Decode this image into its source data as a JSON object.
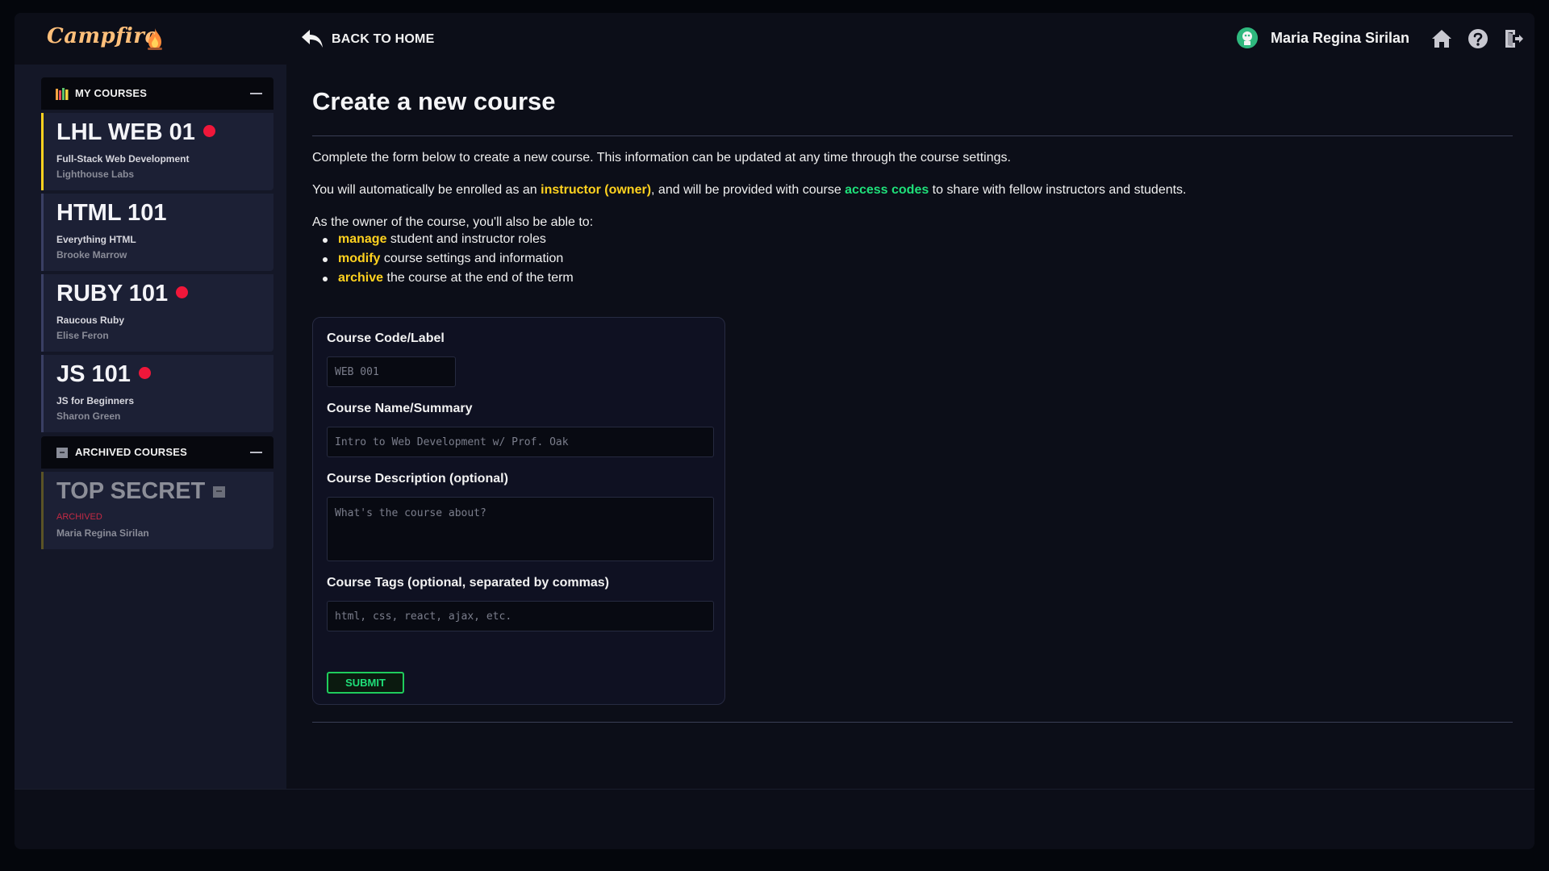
{
  "app": {
    "name": "Campfire"
  },
  "header": {
    "back_label": "BACK TO HOME",
    "user_name": "Maria Regina Sirilan"
  },
  "sidebar": {
    "my_courses": {
      "label": "MY COURSES",
      "items": [
        {
          "code": "LHL WEB 01",
          "name": "Full-Stack Web Development",
          "instructor": "Lighthouse Labs",
          "notification": true,
          "active": true
        },
        {
          "code": "HTML 101",
          "name": "Everything HTML",
          "instructor": "Brooke Marrow",
          "notification": false
        },
        {
          "code": "RUBY 101",
          "name": "Raucous Ruby",
          "instructor": "Elise Feron",
          "notification": true
        },
        {
          "code": "JS 101",
          "name": "JS for Beginners",
          "instructor": "Sharon Green",
          "notification": true
        }
      ]
    },
    "archived_courses": {
      "label": "ARCHIVED COURSES",
      "items": [
        {
          "code": "TOP SECRET",
          "status": "ARCHIVED",
          "instructor": "Maria Regina Sirilan"
        }
      ]
    }
  },
  "main": {
    "title": "Create a new course",
    "intro": "Complete the form below to create a new course. This information can be updated at any time through the course settings.",
    "enroll": {
      "pre": "You will automatically be enrolled as an ",
      "role": "instructor (owner)",
      "mid": ", and will be provided with course ",
      "codes": "access codes",
      "post": " to share with fellow instructors and students."
    },
    "owner_intro": "As the owner of the course, you'll also be able to:",
    "abilities": [
      {
        "verb": "manage",
        "rest": " student and instructor roles"
      },
      {
        "verb": "modify",
        "rest": " course settings and information"
      },
      {
        "verb": "archive",
        "rest": " the course at the end of the term"
      }
    ],
    "form": {
      "code_label": "Course Code/Label",
      "code_placeholder": "WEB 001",
      "name_label": "Course Name/Summary",
      "name_placeholder": "Intro to Web Development w/ Prof. Oak",
      "desc_label": "Course Description (optional)",
      "desc_placeholder": "What's the course about?",
      "tags_label": "Course Tags (optional, separated by commas)",
      "tags_placeholder": "html, css, react, ajax, etc.",
      "submit_label": "SUBMIT"
    }
  },
  "colors": {
    "accent_yellow": "#ffd21f",
    "accent_green": "#1fe07a",
    "notification_red": "#f0173a",
    "archived_red": "#c42a44"
  },
  "icons": [
    "campfire-flame-icon",
    "books-icon",
    "archive-box-icon",
    "reply-arrow-icon",
    "avatar-icon",
    "home-icon",
    "help-icon",
    "logout-icon"
  ]
}
